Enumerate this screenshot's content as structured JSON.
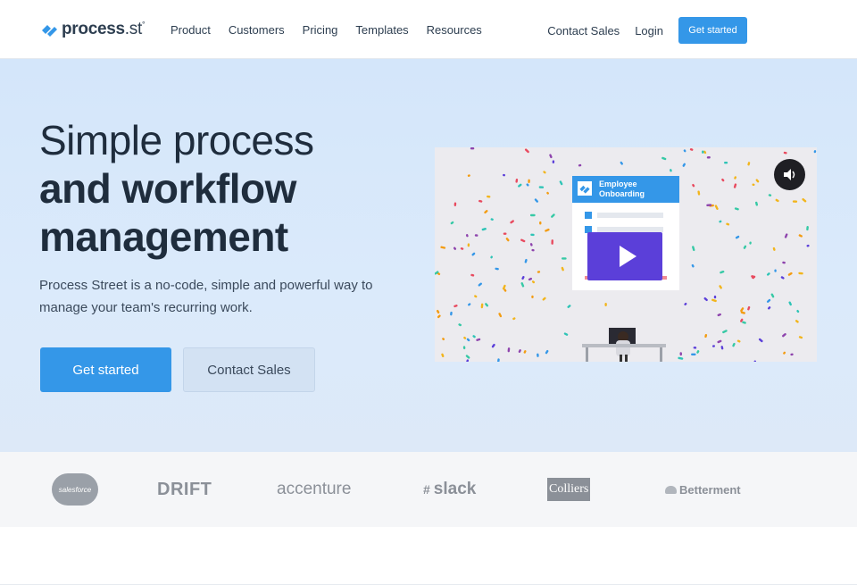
{
  "header": {
    "logo_main": "process",
    "logo_sub": ".st",
    "logo_mark": "°",
    "nav": [
      "Product",
      "Customers",
      "Pricing",
      "Templates",
      "Resources"
    ],
    "contact_sales": "Contact Sales",
    "login": "Login",
    "get_started": "Get started",
    "accent_color": "#3497e8"
  },
  "hero": {
    "title_light": "Simple process",
    "title_bold": "and workflow management",
    "description": "Process Street is a no-code, simple and powerful way to manage your team's recurring work.",
    "primary_button": "Get started",
    "secondary_button": "Contact Sales"
  },
  "video": {
    "card_title": "Employee Onboarding",
    "play_color": "#5b3fd9",
    "icons": [
      "play-icon",
      "speaker-icon"
    ]
  },
  "logos": {
    "salesforce": "salesforce",
    "drift": "DRIFT",
    "accenture": "accenture",
    "slack": "slack",
    "colliers": "Colliers",
    "betterment": "Betterment"
  }
}
